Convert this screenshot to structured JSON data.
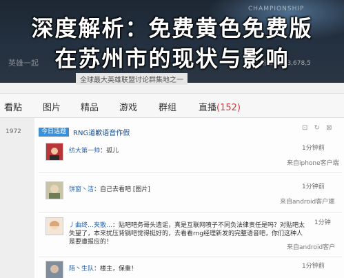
{
  "headline": {
    "line1": "深度解析：免费黄色免费版",
    "line2": "在苏州市的现状与影响"
  },
  "banner": {
    "logo": "CHAMPIONSHIP",
    "subtitle": "英雄一起",
    "right_info": "粉丝：183,678,5"
  },
  "slogan": "全球最大英雄联盟讨论群集地之一",
  "tabs": [
    {
      "label": "看贴"
    },
    {
      "label": "图片"
    },
    {
      "label": "精品"
    },
    {
      "label": "游戏"
    },
    {
      "label": "群组"
    },
    {
      "label": "直播",
      "count": "(152)"
    }
  ],
  "left_number": "1972",
  "thread": {
    "badge": "今日话题",
    "title": "RNG道歉语音作假"
  },
  "header_icons": "⊡ ↻ ⊠",
  "posts": [
    {
      "user": "纺大第一帅",
      "text": "孤儿",
      "time": "1分钟前",
      "source": "来自iphone客户端",
      "avatar_color": "#b8353a"
    },
    {
      "user": "饼窗丶洁",
      "text": "自己去看吧 [图片]",
      "time": "1分钟前",
      "source": "来自android客户端",
      "avatar_color": "#8a9a6b"
    },
    {
      "user": "丿曲终…夹散…",
      "text": "贴吧吧务哥头造谣，真是互联网喷子不同负法律责任是吗？对贴吧太",
      "text2": "失望了，本来扰压背锅吧觉得挺好的，去看看rng经理新发的完整语音吧，你们这种人",
      "text3": "是要遭报应的！",
      "time": "1分钟",
      "source": "来自android客户",
      "avatar_color": "#e8c9a6"
    },
    {
      "user": "陌丶生队",
      "text": "楼主，保重！",
      "time": "1分钟前",
      "avatar_color": "#6f7d8c"
    }
  ]
}
